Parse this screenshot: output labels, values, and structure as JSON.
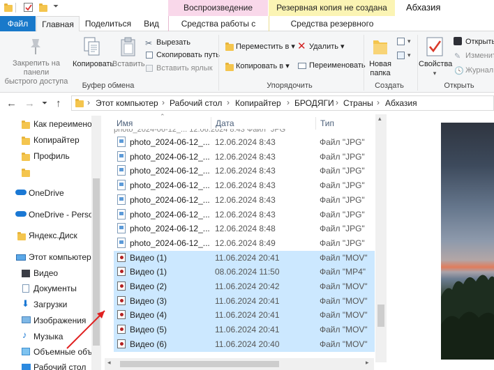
{
  "window": {
    "title": "Абхазия"
  },
  "context_tabs": {
    "playback": "Воспроизведение",
    "backup": "Резервная копия не создана"
  },
  "ribbon_tabs": {
    "file": "Файл",
    "home": "Главная",
    "share": "Поделиться",
    "view": "Вид",
    "video_tools": "Средства работы с видео",
    "backup_tools": "Средства резервного копирования"
  },
  "ribbon": {
    "clipboard": {
      "pin": "Закрепить на панели быстрого доступа",
      "pin_line1": "Закрепить на панели",
      "pin_line2": "быстрого доступа",
      "copy": "Копировать",
      "paste": "Вставить",
      "cut": "Вырезать",
      "copy_path": "Скопировать путь",
      "paste_shortcut": "Вставить ярлык",
      "label": "Буфер обмена"
    },
    "organize": {
      "move_to": "Переместить в",
      "copy_to": "Копировать в",
      "delete": "Удалить",
      "rename": "Переименовать",
      "label": "Упорядочить"
    },
    "new": {
      "new_folder_line1": "Новая",
      "new_folder_line2": "папка",
      "label": "Создать"
    },
    "open": {
      "properties": "Свойства",
      "open": "Открыть",
      "edit": "Изменить",
      "history": "Журнал",
      "label": "Открыть"
    }
  },
  "breadcrumb": [
    "Этот компьютер",
    "Рабочий стол",
    "Копирайтер",
    "БРОДЯГИ",
    "Страны",
    "Абхазия"
  ],
  "nav_pane": {
    "items": [
      "Как переимено",
      "Копирайтер",
      "Профиль",
      "",
      "OneDrive",
      "OneDrive - Person",
      "Яндекс.Диск",
      "Этот компьютер",
      "Видео",
      "Документы",
      "Загрузки",
      "Изображения",
      "Музыка",
      "Объемные объ",
      "Рабочий стол"
    ]
  },
  "columns": {
    "name": "Имя",
    "date": "Дата",
    "type": "Тип"
  },
  "files": [
    {
      "name": "photo_2024-06-12_...",
      "date": "12.06.2024 8:43",
      "type": "Файл \"JPG\"",
      "kind": "image",
      "selected": false
    },
    {
      "name": "photo_2024-06-12_...",
      "date": "12.06.2024 8:43",
      "type": "Файл \"JPG\"",
      "kind": "image",
      "selected": false
    },
    {
      "name": "photo_2024-06-12_...",
      "date": "12.06.2024 8:43",
      "type": "Файл \"JPG\"",
      "kind": "image",
      "selected": false
    },
    {
      "name": "photo_2024-06-12_...",
      "date": "12.06.2024 8:43",
      "type": "Файл \"JPG\"",
      "kind": "image",
      "selected": false
    },
    {
      "name": "photo_2024-06-12_...",
      "date": "12.06.2024 8:43",
      "type": "Файл \"JPG\"",
      "kind": "image",
      "selected": false
    },
    {
      "name": "photo_2024-06-12_...",
      "date": "12.06.2024 8:43",
      "type": "Файл \"JPG\"",
      "kind": "image",
      "selected": false
    },
    {
      "name": "photo_2024-06-12_...",
      "date": "12.06.2024 8:48",
      "type": "Файл \"JPG\"",
      "kind": "image",
      "selected": false
    },
    {
      "name": "photo_2024-06-12_...",
      "date": "12.06.2024 8:49",
      "type": "Файл \"JPG\"",
      "kind": "image",
      "selected": false
    },
    {
      "name": "Видео (1)",
      "date": "11.06.2024 20:41",
      "type": "Файл \"MOV\"",
      "kind": "video",
      "selected": true
    },
    {
      "name": "Видео (1)",
      "date": "08.06.2024 11:50",
      "type": "Файл \"MP4\"",
      "kind": "video",
      "selected": true
    },
    {
      "name": "Видео (2)",
      "date": "11.06.2024 20:42",
      "type": "Файл \"MOV\"",
      "kind": "video",
      "selected": true
    },
    {
      "name": "Видео (3)",
      "date": "11.06.2024 20:41",
      "type": "Файл \"MOV\"",
      "kind": "video",
      "selected": true
    },
    {
      "name": "Видео (4)",
      "date": "11.06.2024 20:41",
      "type": "Файл \"MOV\"",
      "kind": "video",
      "selected": true
    },
    {
      "name": "Видео (5)",
      "date": "11.06.2024 20:41",
      "type": "Файл \"MOV\"",
      "kind": "video",
      "selected": true
    },
    {
      "name": "Видео (6)",
      "date": "11.06.2024 20:40",
      "type": "Файл \"MOV\"",
      "kind": "video",
      "selected": true
    }
  ],
  "colors": {
    "file_tab": "#1979ca",
    "selection": "#cce8ff",
    "arrow": "#e02020"
  }
}
